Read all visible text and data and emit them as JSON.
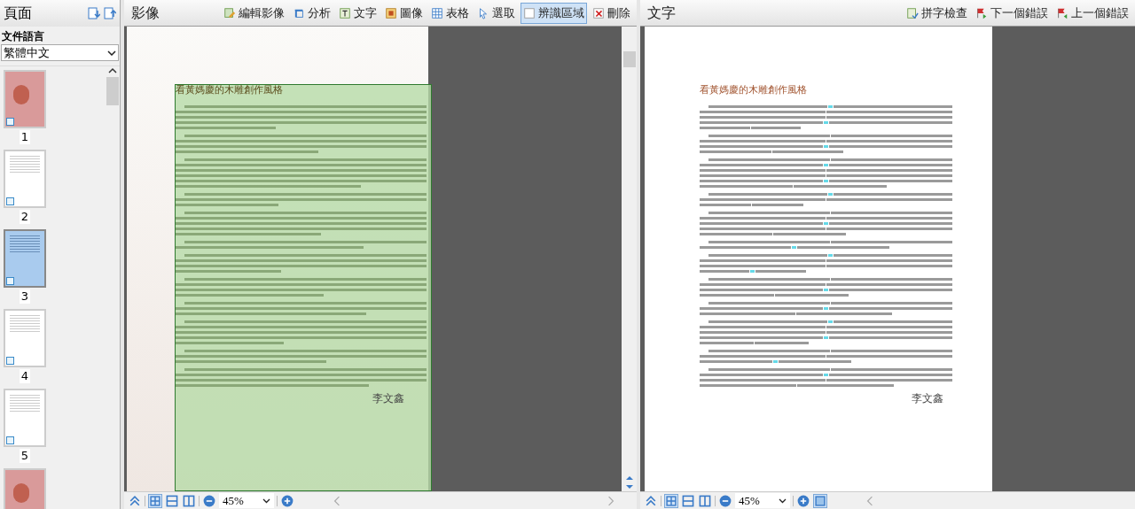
{
  "sidebar": {
    "title": "頁面",
    "language_label": "文件語言",
    "language": "繁體中文",
    "pages": [
      {
        "label": "1",
        "kind": "cover",
        "selected": false
      },
      {
        "label": "2",
        "kind": "text",
        "selected": false
      },
      {
        "label": "3",
        "kind": "text",
        "selected": true
      },
      {
        "label": "4",
        "kind": "text",
        "selected": false
      },
      {
        "label": "5",
        "kind": "text",
        "selected": false
      },
      {
        "kind": "cover",
        "selected": false
      }
    ]
  },
  "image_pane": {
    "title": "影像",
    "tools": [
      {
        "label": "編輯影像",
        "kind": "edit",
        "selected": false
      },
      {
        "label": "分析",
        "kind": "analyze",
        "selected": false
      },
      {
        "label": "文字",
        "kind": "text",
        "selected": false
      },
      {
        "label": "圖像",
        "kind": "picture",
        "selected": false
      },
      {
        "label": "表格",
        "kind": "table",
        "selected": false
      },
      {
        "label": "選取",
        "kind": "select",
        "selected": false
      },
      {
        "label": "辨識區域",
        "kind": "area",
        "selected": true
      },
      {
        "label": "刪除",
        "kind": "delete",
        "selected": false
      }
    ],
    "document": {
      "title": "看黃媽慶的木雕創作風格",
      "signature": "李文鑫"
    },
    "zoom": "45%"
  },
  "text_pane": {
    "title": "文字",
    "tools": [
      {
        "label": "拼字檢查",
        "kind": "spell"
      },
      {
        "label": "下一個錯誤",
        "kind": "next"
      },
      {
        "label": "上一個錯誤",
        "kind": "prev"
      }
    ],
    "document": {
      "title": "看黃媽慶的木雕創作風格",
      "signature": "李文鑫"
    },
    "zoom": "45%"
  }
}
